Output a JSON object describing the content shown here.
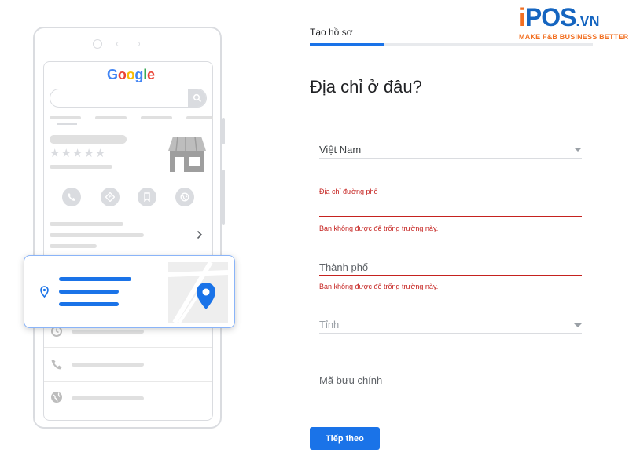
{
  "logo": {
    "i": "i",
    "pos": "POS",
    "vn": ".VN",
    "tagline": "MAKE F&B BUSINESS BETTER"
  },
  "illustration": {
    "google_wordmark": [
      "G",
      "o",
      "o",
      "g",
      "l",
      "e"
    ],
    "stars": "★★★★★"
  },
  "form": {
    "tab_label": "Tạo hồ sơ",
    "progress": 0.26,
    "heading": "Địa chỉ ở đâu?",
    "country": {
      "value": "Việt Nam"
    },
    "street": {
      "label": "Địa chỉ đường phố",
      "error": "Bạn không được để trống trường này."
    },
    "city": {
      "placeholder": "Thành phố",
      "error": "Bạn không được để trống trường này."
    },
    "province": {
      "placeholder": "Tỉnh"
    },
    "postal": {
      "placeholder": "Mã bưu chính"
    },
    "next_label": "Tiếp theo"
  },
  "colors": {
    "accent": "#1a73e8",
    "error": "#c5221f",
    "brand_orange": "#f26f21",
    "brand_blue": "#1565c0"
  }
}
